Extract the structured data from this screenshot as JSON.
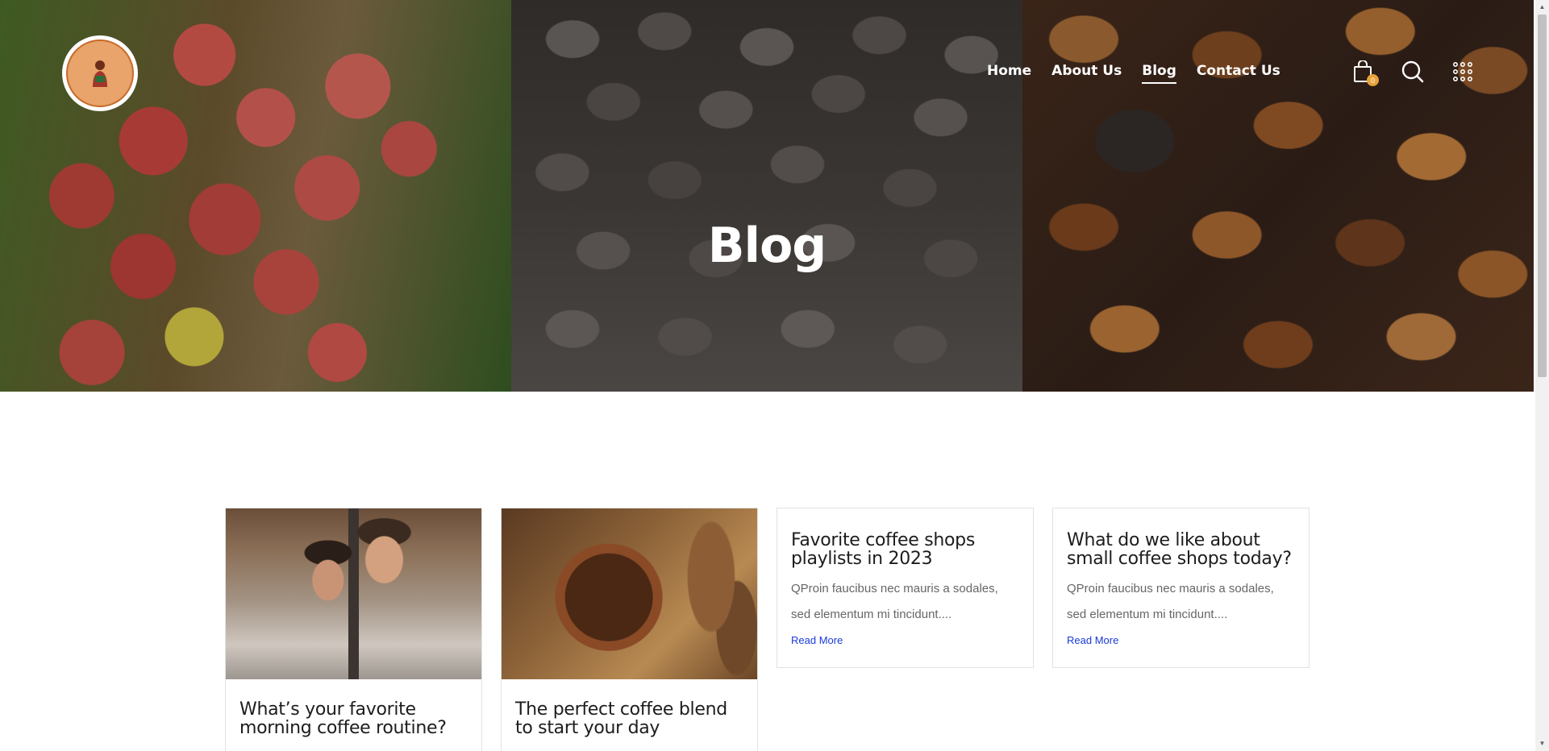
{
  "brand": {
    "logo_alt": "Isianta coffee"
  },
  "nav": {
    "items": [
      {
        "label": "Home",
        "active": false
      },
      {
        "label": "About Us",
        "active": false
      },
      {
        "label": "Blog",
        "active": true
      },
      {
        "label": "Contact Us",
        "active": false
      }
    ]
  },
  "header_icons": {
    "cart_icon": "shopping-bag-icon",
    "cart_count": "0",
    "search_icon": "search-icon",
    "menu_icon": "grid-dots-icon"
  },
  "hero": {
    "title": "Blog",
    "panels": [
      "coffee cherries",
      "green coffee beans",
      "roasted coffee beans"
    ]
  },
  "posts": [
    {
      "title": "What’s your favorite morning coffee routine?",
      "has_image": true
    },
    {
      "title": "The perfect coffee blend to start your day",
      "has_image": true
    },
    {
      "title": "Favorite coffee shops playlists in 2023",
      "excerpt": "QProin faucibus nec mauris a sodales, sed elementum mi tincidunt....",
      "link": "Read More",
      "has_image": false
    },
    {
      "title": "What do we like about small coffee shops today?",
      "excerpt": "QProin faucibus nec mauris a sodales, sed elementum mi tincidunt....",
      "link": "Read More",
      "has_image": false
    }
  ],
  "colors": {
    "accent": "#e8a23a",
    "link": "#1a3ad8",
    "title_text": "#1d1d1d",
    "body_text": "#666666"
  }
}
